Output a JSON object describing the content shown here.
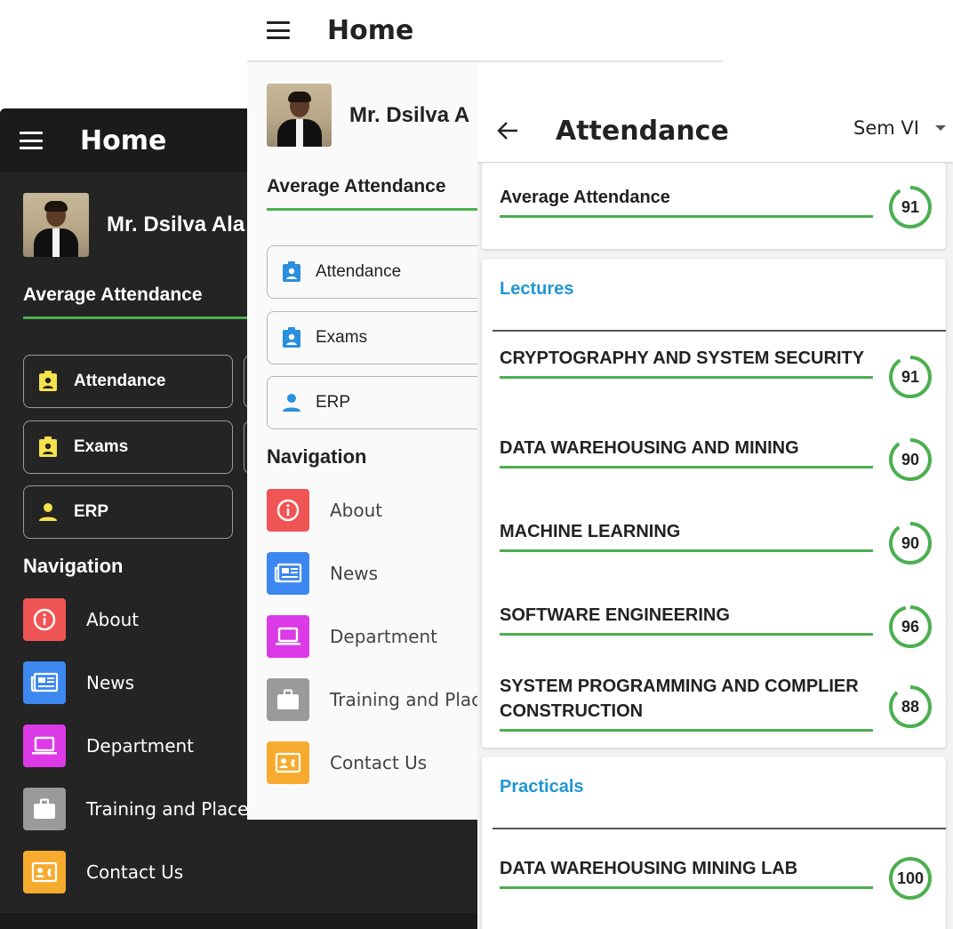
{
  "dark_screen": {
    "appbar_title": "Home",
    "profile_name": "Mr. Dsilva Ala",
    "avg_attendance_label": "Average Attendance",
    "buttons": [
      {
        "label": "Attendance",
        "icon": "badge-icon"
      },
      {
        "label": "Exams",
        "icon": "badge-icon"
      },
      {
        "label": "ERP",
        "icon": "person-icon"
      }
    ],
    "navigation_heading": "Navigation",
    "nav_items": [
      {
        "label": "About",
        "icon": "info-icon",
        "color": "#f05555"
      },
      {
        "label": "News",
        "icon": "newspaper-icon",
        "color": "#3d88f0"
      },
      {
        "label": "Department",
        "icon": "laptop-icon",
        "color": "#db3ae6"
      },
      {
        "label": "Training and Place",
        "icon": "briefcase-icon",
        "color": "#9a9a9a"
      },
      {
        "label": "Contact Us",
        "icon": "contact-card-icon",
        "color": "#f6ab2f"
      }
    ],
    "accent_icon_color": "#f5e14a"
  },
  "light_screen": {
    "appbar_title": "Home",
    "profile_name": "Mr. Dsilva A",
    "avg_attendance_label": "Average Attendance",
    "buttons": [
      {
        "label": "Attendance",
        "icon": "badge-icon"
      },
      {
        "label": "Exams",
        "icon": "badge-icon"
      },
      {
        "label": "ERP",
        "icon": "person-icon"
      }
    ],
    "navigation_heading": "Navigation",
    "nav_items": [
      {
        "label": "About",
        "icon": "info-icon",
        "color": "#f05555"
      },
      {
        "label": "News",
        "icon": "newspaper-icon",
        "color": "#3d88f0"
      },
      {
        "label": "Department",
        "icon": "laptop-icon",
        "color": "#db3ae6"
      },
      {
        "label": "Training and Plac",
        "icon": "briefcase-icon",
        "color": "#9a9a9a"
      },
      {
        "label": "Contact Us",
        "icon": "contact-card-icon",
        "color": "#f6ab2f"
      }
    ],
    "accent_icon_color": "#2a8fdc"
  },
  "attendance_screen": {
    "title": "Attendance",
    "semester": "Sem VI",
    "average": {
      "label": "Average Attendance",
      "value": "91",
      "percent": 91
    },
    "lectures_heading": "Lectures",
    "lectures": [
      {
        "subject": "CRYPTOGRAPHY AND SYSTEM SECURITY",
        "value": "91",
        "percent": 91
      },
      {
        "subject": "DATA WAREHOUSING AND MINING",
        "value": "90",
        "percent": 90
      },
      {
        "subject": "MACHINE LEARNING",
        "value": "90",
        "percent": 90
      },
      {
        "subject": "SOFTWARE ENGINEERING",
        "value": "96",
        "percent": 96
      },
      {
        "subject": "SYSTEM PROGRAMMING AND COMPLIER CONSTRUCTION",
        "value": "88",
        "percent": 88
      }
    ],
    "practicals_heading": "Practicals",
    "practicals": [
      {
        "subject": "DATA WAREHOUSING MINING LAB",
        "value": "100",
        "percent": 100
      }
    ],
    "ring_color": "#4caf50",
    "heading_color": "#2196d3"
  }
}
